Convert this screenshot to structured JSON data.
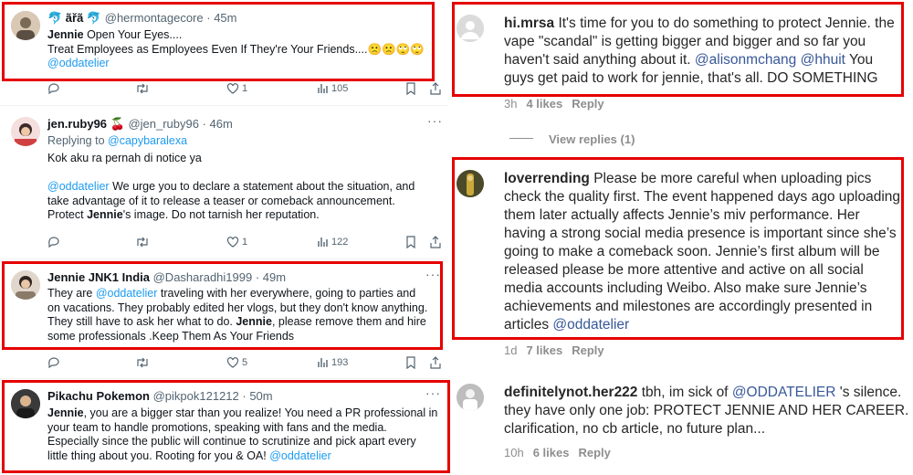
{
  "tweets": [
    {
      "name": "🐬 ãřã 🐬",
      "handle": "@hermontagecore",
      "time": "· 45m",
      "lines": [
        [
          {
            "b": "Jennie"
          },
          {
            "t": " Open Your Eyes...."
          }
        ],
        [
          {
            "t": "Treat Employees as Employees Even If They're Your Friends....🙁🙁🙄🙄"
          }
        ],
        [
          {
            "m": "@oddatelier"
          }
        ]
      ],
      "replies": "",
      "retweets": "",
      "likes": "1",
      "views": "105"
    },
    {
      "name": "jen.ruby96 🍒",
      "handle": "@jen_ruby96",
      "time": "· 46m",
      "reply_prefix": "Replying to ",
      "reply_to": "@capybaralexa",
      "lines": [
        [
          {
            "t": "Kok aku ra pernah di notice ya"
          }
        ],
        [
          {
            "t": ""
          }
        ],
        [
          {
            "m": "@oddatelier"
          },
          {
            "t": " We urge you to declare a statement about the situation, and"
          }
        ],
        [
          {
            "t": "take advantage of it to release a teaser or comeback announcement."
          }
        ],
        [
          {
            "t": "Protect "
          },
          {
            "b": "Jennie"
          },
          {
            "t": "'s image. Do not tarnish her reputation."
          }
        ]
      ],
      "replies": "",
      "retweets": "",
      "likes": "1",
      "views": "122"
    },
    {
      "name": "Jennie JNK1 India",
      "handle": "@Dasharadhi1999",
      "time": "· 49m",
      "lines": [
        [
          {
            "t": "They are "
          },
          {
            "m": "@oddatelier"
          },
          {
            "t": "  traveling with her everywhere, going to parties and"
          }
        ],
        [
          {
            "t": "on vacations. They probably edited her vlogs, but they don't know anything."
          }
        ],
        [
          {
            "t": "They still have to ask her what to do. "
          },
          {
            "b": "Jennie"
          },
          {
            "t": ", please remove them and hire"
          }
        ],
        [
          {
            "t": "some professionals .Keep Them As Your Friends"
          }
        ]
      ],
      "replies": "",
      "retweets": "",
      "likes": "5",
      "views": "193"
    },
    {
      "name": "Pikachu Pokemon",
      "handle": "@pikpok121212",
      "time": "· 50m",
      "lines": [
        [
          {
            "b": "Jennie"
          },
          {
            "t": ", you are a bigger star than you realize! You need a PR professional in"
          }
        ],
        [
          {
            "t": "your team to handle promotions, speaking with fans and the media."
          }
        ],
        [
          {
            "t": "Especially since the public will continue to scrutinize and pick apart every"
          }
        ],
        [
          {
            "t": "little thing about you. Rooting for you & OA!  "
          },
          {
            "m": "@oddatelier"
          }
        ]
      ]
    }
  ],
  "comments": [
    {
      "username": "hi.mrsa",
      "lines": [
        [
          {
            "u": "hi.mrsa"
          },
          {
            "t": " It's time for you to do something to protect Jennie. the"
          }
        ],
        [
          {
            "t": "vape \"scandal\" is getting bigger and bigger and so far you"
          }
        ],
        [
          {
            "t": "haven't said anything about it. "
          },
          {
            "m": "@alisonmchang"
          },
          {
            "t": " "
          },
          {
            "m": "@hhuit"
          },
          {
            "t": " You"
          }
        ],
        [
          {
            "t": "guys get paid to work for jennie, that's all. DO SOMETHING"
          }
        ]
      ],
      "time": "3h",
      "likes": "4 likes",
      "reply": "Reply",
      "view_replies": "View replies (1)"
    },
    {
      "username": "loverrending",
      "lines": [
        [
          {
            "u": "loverrending"
          },
          {
            "t": " Please be more careful when uploading pics"
          }
        ],
        [
          {
            "t": "check the quality first. The event happened days ago uploading"
          }
        ],
        [
          {
            "t": "them later actually affects Jennie’s miv performance. Her"
          }
        ],
        [
          {
            "t": "having a strong social media presence is important since she’s"
          }
        ],
        [
          {
            "t": "going to make a comeback soon. Jennie’s first album will be"
          }
        ],
        [
          {
            "t": "released please be more attentive and active on all social"
          }
        ],
        [
          {
            "t": "media accounts including Weibo. Also make sure Jennie’s"
          }
        ],
        [
          {
            "t": "achievements and milestones are accordingly presented in"
          }
        ],
        [
          {
            "t": "articles "
          },
          {
            "m": "@oddatelier"
          }
        ]
      ],
      "time": "1d",
      "likes": "7 likes",
      "reply": "Reply"
    },
    {
      "username": "definitelynot.her222",
      "lines": [
        [
          {
            "u": "definitelynot.her222"
          },
          {
            "t": " tbh, im sick of "
          },
          {
            "m": "@ODDATELIER"
          },
          {
            "t": " 's silence."
          }
        ],
        [
          {
            "t": "they have only one job: PROTECT JENNIE AND HER CAREER. no"
          }
        ],
        [
          {
            "t": "clarification, no cb article, no future plan..."
          }
        ]
      ],
      "time": "10h",
      "likes": "6 likes",
      "reply": "Reply"
    }
  ],
  "icons": {
    "reply": "reply-icon",
    "retweet": "retweet-icon",
    "like": "heart-icon",
    "views": "views-icon",
    "bookmark": "bookmark-icon",
    "share": "share-icon",
    "more": "more-icon"
  },
  "colors": {
    "highlight_border": "#e60000",
    "twitter_mention": "#1d9bf0",
    "instagram_mention": "#385898",
    "muted": "#536471"
  }
}
